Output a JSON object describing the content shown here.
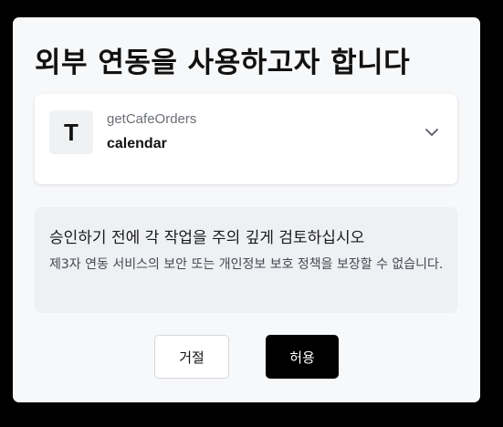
{
  "dialog": {
    "title": "외부 연동을 사용하고자 합니다",
    "tool": {
      "icon_letter": "T",
      "name": "getCafeOrders",
      "subtitle": "calendar",
      "expand_icon": "chevron-down-icon"
    },
    "warning": {
      "title": "승인하기 전에 각 작업을 주의 깊게 검토하십시오",
      "body": "제3자 연동 서비스의 보안 또는 개인정보 보호 정책을 보장할 수 없습니다."
    },
    "buttons": {
      "deny_label": "거절",
      "allow_label": "허용"
    }
  },
  "colors": {
    "background": "#000000",
    "dialog": "#f7f8fa",
    "primary_button": "#000000",
    "warning_bg": "#eef0f3"
  }
}
